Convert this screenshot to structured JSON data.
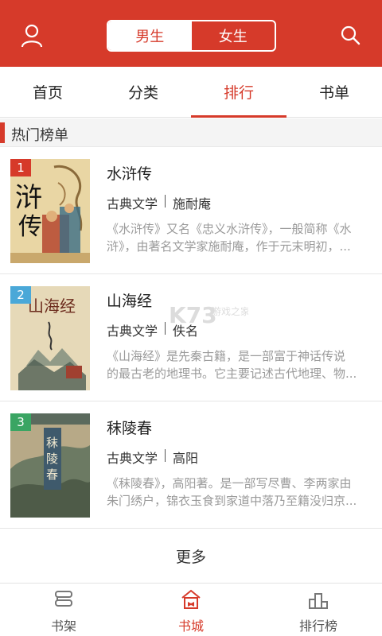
{
  "colors": {
    "accent": "#d63a2a",
    "rank1": "#d63a2a",
    "rank2": "#4aa8d8",
    "rank3": "#3aa563"
  },
  "header": {
    "user_icon": "user-icon",
    "search_icon": "search-icon",
    "segments": [
      {
        "label": "男生",
        "active": true
      },
      {
        "label": "女生",
        "active": false
      }
    ]
  },
  "tabs": [
    {
      "label": "首页"
    },
    {
      "label": "分类"
    },
    {
      "label": "排行",
      "active": true
    },
    {
      "label": "书单"
    }
  ],
  "section": {
    "title": "热门榜单"
  },
  "books": [
    {
      "rank": "1",
      "title": "水浒传",
      "category": "古典文学",
      "author": "施耐庵",
      "desc_line1": "《水浒传》又名《忠义水浒传》，一般简称《水",
      "desc_line2": "浒》，由著名文学家施耐庵，作于元末明初，..."
    },
    {
      "rank": "2",
      "title": "山海经",
      "category": "古典文学",
      "author": "佚名",
      "desc_line1": "《山海经》是先秦古籍，是一部富于神话传说",
      "desc_line2": "的最古老的地理书。它主要记述古代地理、物..."
    },
    {
      "rank": "3",
      "title": "秣陵春",
      "category": "古典文学",
      "author": "高阳",
      "desc_line1": "《秣陵春》，高阳著。是一部写尽曹、李两家由",
      "desc_line2": "朱门绣户，锦衣玉食到家道中落乃至籍没归京..."
    }
  ],
  "more_label": "更多",
  "bottom_nav": [
    {
      "label": "书架",
      "icon": "bookshelf-icon"
    },
    {
      "label": "书城",
      "icon": "bookstore-icon",
      "active": true
    },
    {
      "label": "排行榜",
      "icon": "ranking-icon"
    }
  ],
  "watermark": {
    "text": "游戏之家"
  }
}
